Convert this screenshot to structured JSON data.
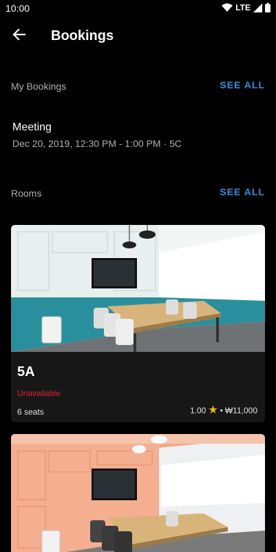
{
  "status_bar": {
    "time": "10:00",
    "network": "LTE"
  },
  "app_bar": {
    "title": "Bookings"
  },
  "my_bookings": {
    "title": "My Bookings",
    "see_all": "SEE ALL",
    "items": [
      {
        "title": "Meeting",
        "subtitle": "Dec 20, 2019, 12:30 PM - 1:00 PM · 5C"
      }
    ]
  },
  "rooms": {
    "title": "Rooms",
    "see_all": "SEE ALL",
    "items": [
      {
        "name": "5A",
        "status": "Unavailable",
        "seats": "6 seats",
        "rating": "1.00",
        "separator": "•",
        "price": "₩11,000",
        "wall_color": "#2a8f9c"
      },
      {
        "name": "",
        "status": "",
        "seats": "",
        "rating": "",
        "price": "",
        "wall_color": "#f2a98a"
      }
    ]
  },
  "colors": {
    "accent": "#2f8fe0",
    "unavailable": "#e0223a",
    "star": "#f5b800",
    "background": "#000000",
    "card": "#171717"
  },
  "icons": {
    "back": "arrow-left-icon",
    "wifi": "wifi-icon",
    "signal": "signal-icon",
    "battery": "battery-icon",
    "rating": "star-icon"
  }
}
